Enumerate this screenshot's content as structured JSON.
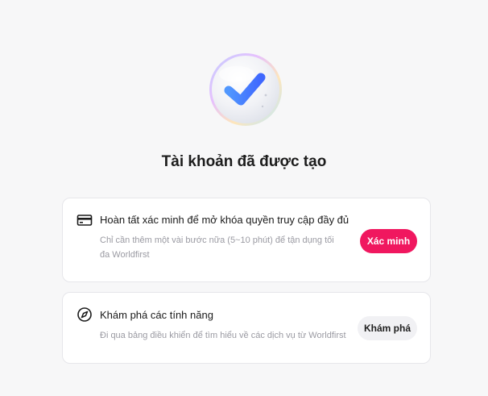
{
  "header": {
    "title": "Tài khoản đã được tạo"
  },
  "hero": {
    "icon": "check-badge-icon"
  },
  "cards": {
    "verify": {
      "icon": "credit-card-icon",
      "heading": "Hoàn tất xác minh để mở khóa quyền truy cập đầy đủ",
      "description": "Chỉ cần thêm một vài bước nữa (5~10 phút) để tận dụng tối đa Worldfirst",
      "button_label": "Xác minh",
      "button_color": "#f0175f"
    },
    "explore": {
      "icon": "compass-icon",
      "heading": "Khám phá các tính năng",
      "description": "Đi qua bảng điều khiển để tìm hiểu về các dịch vụ từ Worldfirst",
      "button_label": "Khám phá"
    }
  }
}
